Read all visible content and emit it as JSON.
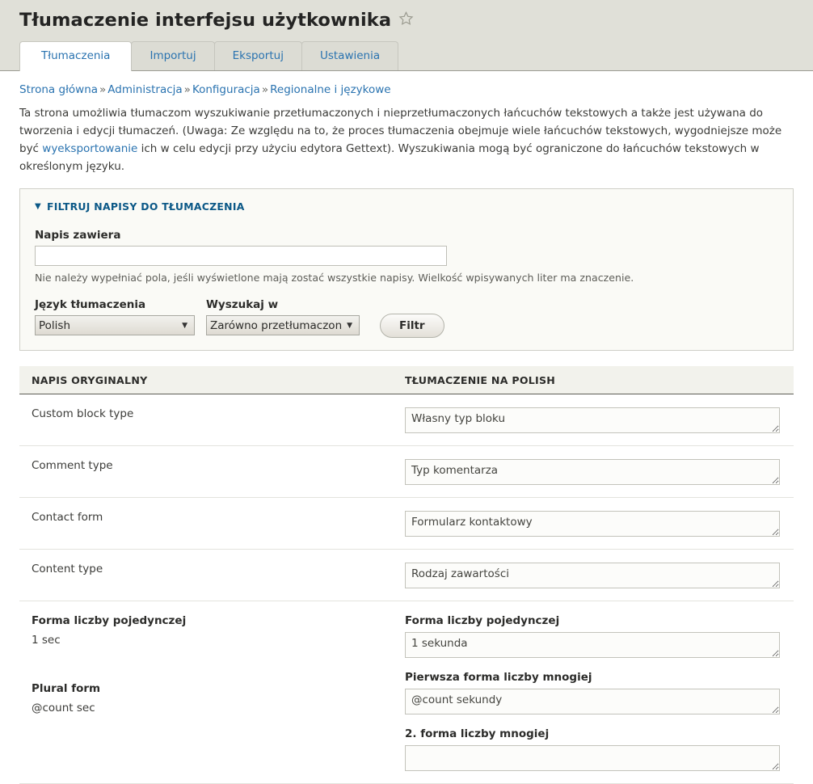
{
  "header": {
    "title": "Tłumaczenie interfejsu użytkownika",
    "star_icon": "star-outline-icon",
    "tabs": [
      {
        "label": "Tłumaczenia",
        "active": true
      },
      {
        "label": "Importuj",
        "active": false
      },
      {
        "label": "Eksportuj",
        "active": false
      },
      {
        "label": "Ustawienia",
        "active": false
      }
    ]
  },
  "breadcrumb": {
    "items": [
      "Strona główna",
      "Administracja",
      "Konfiguracja",
      "Regionalne i językowe"
    ],
    "separator": "»"
  },
  "intro": {
    "part1": "Ta strona umożliwia tłumaczom wyszukiwanie przetłumaczonych i nieprzetłumaczonych łańcuchów tekstowych a także jest używana do tworzenia i edycji tłumaczeń. (Uwaga: Ze względu na to, że proces tłumaczenia obejmuje wiele łańcuchów tekstowych, wygodniejsze może być ",
    "link": "wyeksportowanie",
    "part2": " ich w celu edycji przy użyciu edytora Gettext). Wyszukiwania mogą być ograniczone do łańcuchów tekstowych w określonym języku."
  },
  "filter": {
    "legend": "FILTRUJ NAPISY DO TŁUMACZENIA",
    "toggle_icon": "triangle-down-icon",
    "string_label": "Napis zawiera",
    "string_value": "",
    "string_placeholder": "",
    "string_help": "Nie należy wypełniać pola, jeśli wyświetlone mają zostać wszystkie napisy. Wielkość wpisywanych liter ma znaczenie.",
    "language_label": "Język tłumaczenia",
    "language_value": "Polish",
    "language_options": [
      "Polish"
    ],
    "scope_label": "Wyszukaj w",
    "scope_value": "Zarówno przetłumaczon",
    "scope_options": [
      "Zarówno przetłumaczon"
    ],
    "submit_label": "Filtr",
    "dropdown_icon": "chevron-down-icon"
  },
  "table": {
    "col_original": "NAPIS ORYGINALNY",
    "col_translation": "TŁUMACZENIE NA POLISH",
    "rows": [
      {
        "source": "Custom block type",
        "translation": "Własny typ bloku"
      },
      {
        "source": "Comment type",
        "translation": "Typ komentarza"
      },
      {
        "source": "Contact form",
        "translation": "Formularz kontaktowy"
      },
      {
        "source": "Content type",
        "translation": "Rodzaj zawartości"
      }
    ],
    "plural_row": {
      "source_blocks": [
        {
          "title": "Forma liczby pojedynczej",
          "text": "1 sec"
        },
        {
          "title": "Plural form",
          "text": "@count sec"
        }
      ],
      "target_blocks": [
        {
          "label": "Forma liczby pojedynczej",
          "value": "1 sekunda"
        },
        {
          "label": "Pierwsza forma liczby mnogiej",
          "value": "@count sekundy"
        },
        {
          "label": "2. forma liczby mnogiej",
          "value": ""
        }
      ]
    }
  },
  "colors": {
    "header_bg": "#e0e0d8",
    "link": "#2a73b0",
    "legend": "#0b5887",
    "body_bg": "#ffffff",
    "fieldset_bg": "#fafaf6"
  }
}
